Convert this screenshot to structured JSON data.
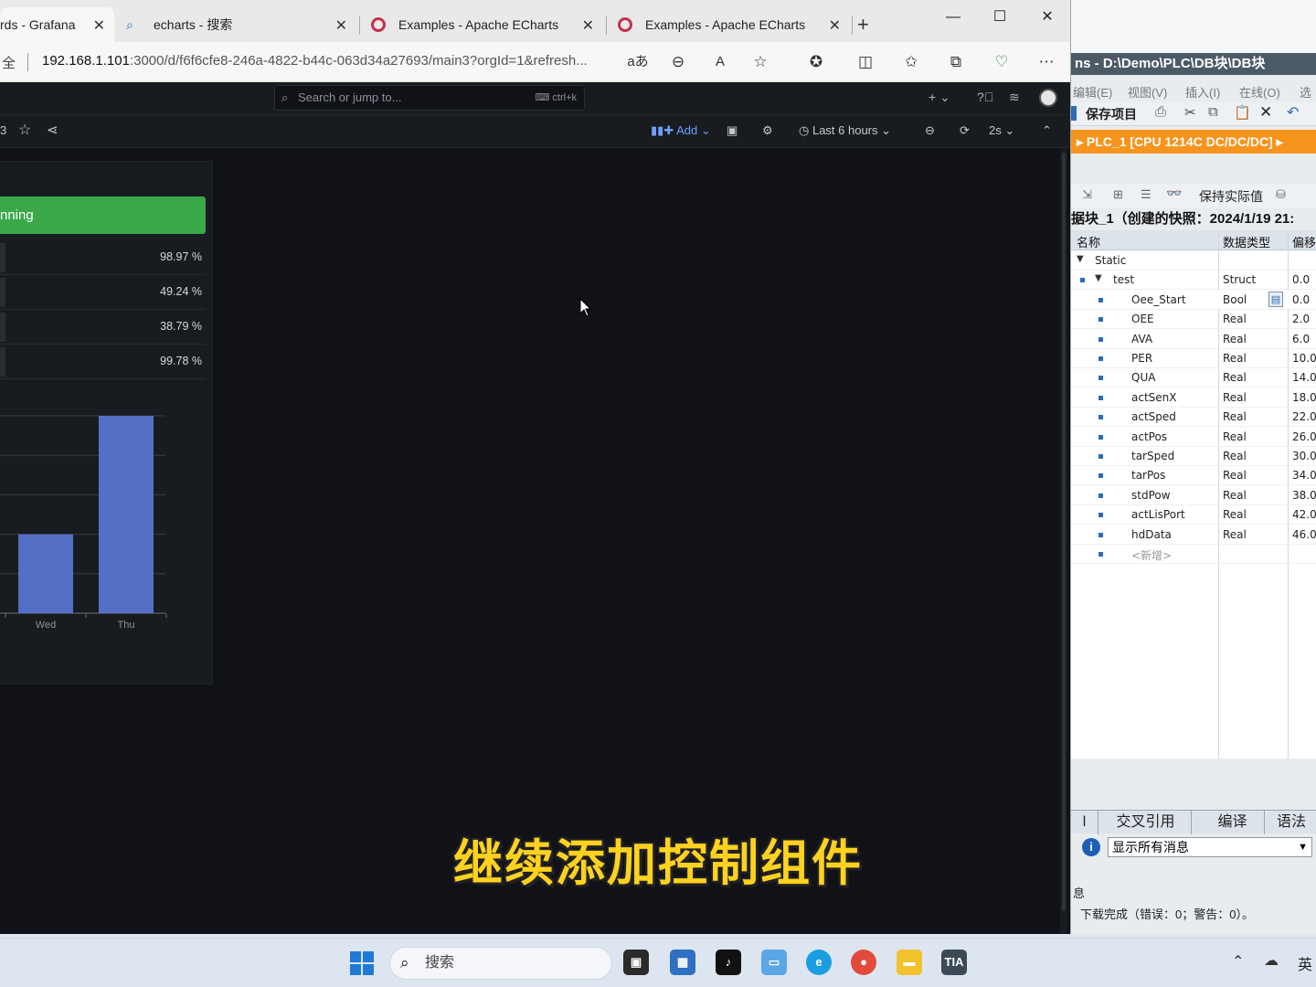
{
  "browser": {
    "tabs": [
      {
        "label": "rds - Grafana"
      },
      {
        "label": "echarts - 搜索"
      },
      {
        "label": "Examples - Apache ECharts"
      },
      {
        "label": "Examples - Apache ECharts"
      }
    ],
    "new_tab": "+",
    "url_prefix": "全",
    "url_host": "192.168.1.101",
    "url_rest": ":3000/d/f6f6cfe8-246a-4822-b44c-063d34a27693/main3?orgId=1&refresh...",
    "window": {
      "minimize": "—",
      "maximize": "☐",
      "close": "✕"
    }
  },
  "grafana": {
    "search_placeholder": "Search or jump to...",
    "search_shortcut": "ctrl+k",
    "breadcrumb_fragment": "3",
    "toolbar": {
      "add_label": "Add",
      "time_range": "Last 6 hours",
      "refresh_interval": "2s"
    },
    "panel": {
      "state_label": "nning",
      "state_color": "#3aa848",
      "stats": [
        {
          "value": "98.97 %"
        },
        {
          "value": "49.24 %"
        },
        {
          "value": "38.79 %"
        },
        {
          "value": "99.78 %"
        }
      ]
    }
  },
  "chart_data": {
    "type": "bar",
    "categories": [
      "Wed",
      "Thu"
    ],
    "values": [
      40,
      100
    ],
    "ylim": [
      0,
      100
    ],
    "grid": true,
    "bar_color": "#5470c6"
  },
  "subtitle": "继续添加控制组件",
  "tia": {
    "title": "ns  -  D:\\Demo\\PLC\\DB块\\DB块",
    "menu": [
      "编辑(E)",
      "视图(V)",
      "插入(I)",
      "在线(O)",
      "选"
    ],
    "save_label": "保存项目",
    "breadcrumb": "PLC_1 [CPU 1214C DC/DC/DC]",
    "snapshot_label": "保持实际值",
    "db_title": "据块_1（创建的快照：2024/1/19 21:",
    "columns": {
      "name": "名称",
      "type": "数据类型",
      "offset": "偏移"
    },
    "rows": [
      {
        "name": "Static",
        "type": "",
        "offset": ""
      },
      {
        "name": "test",
        "type": "Struct",
        "offset": "0.0"
      },
      {
        "name": "Oee_Start",
        "type": "Bool",
        "offset": "0.0"
      },
      {
        "name": "OEE",
        "type": "Real",
        "offset": "2.0"
      },
      {
        "name": "AVA",
        "type": "Real",
        "offset": "6.0"
      },
      {
        "name": "PER",
        "type": "Real",
        "offset": "10.0"
      },
      {
        "name": "QUA",
        "type": "Real",
        "offset": "14.0"
      },
      {
        "name": "actSenX",
        "type": "Real",
        "offset": "18.0"
      },
      {
        "name": "actSped",
        "type": "Real",
        "offset": "22.0"
      },
      {
        "name": "actPos",
        "type": "Real",
        "offset": "26.0"
      },
      {
        "name": "tarSped",
        "type": "Real",
        "offset": "30.0"
      },
      {
        "name": "tarPos",
        "type": "Real",
        "offset": "34.0"
      },
      {
        "name": "stdPow",
        "type": "Real",
        "offset": "38.0"
      },
      {
        "name": "actLisPort",
        "type": "Real",
        "offset": "42.0"
      },
      {
        "name": "hdData",
        "type": "Real",
        "offset": "46.0"
      },
      {
        "name": "<新增>",
        "type": "",
        "offset": ""
      }
    ],
    "bottom_tabs": [
      "交叉引用",
      "编译",
      "语法"
    ],
    "filter_value": "显示所有消息",
    "info_label": "息",
    "status_message": "下载完成（错误：0；警告：0）。"
  },
  "taskbar": {
    "search_label": "搜索",
    "tray_lang": "英"
  }
}
